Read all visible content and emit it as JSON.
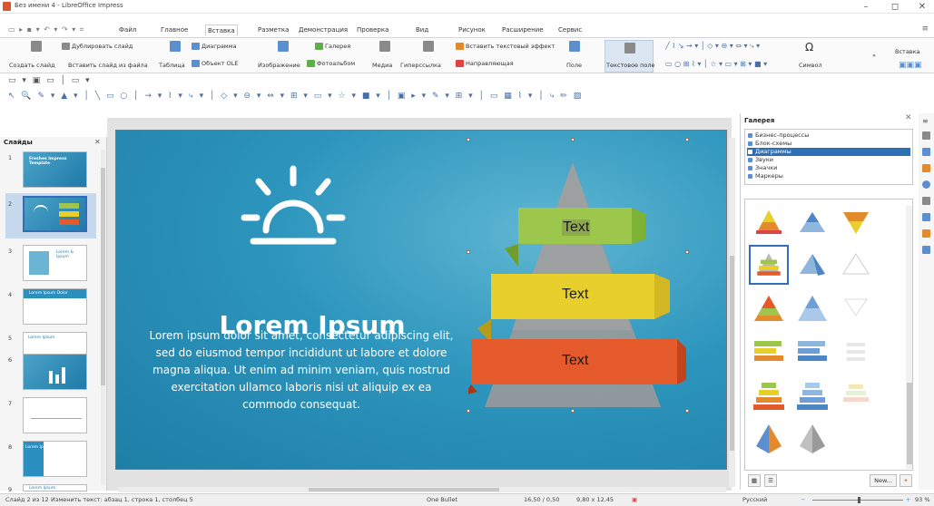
{
  "window": {
    "title": "Без имени 4 - LibreOffice Impress",
    "controls": [
      "–",
      "◻",
      "✕"
    ]
  },
  "menu": {
    "tabs": [
      {
        "label": "Файл"
      },
      {
        "label": "Главное"
      },
      {
        "label": "Вставка"
      },
      {
        "label": "Разметка"
      },
      {
        "label": "Демонстрация"
      },
      {
        "label": "Проверка"
      },
      {
        "label": "Вид"
      },
      {
        "label": "Рисунок"
      },
      {
        "label": "Расширение"
      },
      {
        "label": "Сервис"
      }
    ],
    "active_tab": "Вставка"
  },
  "ribbon": {
    "new_slide": "Создать слайд",
    "duplicate_slide": "Дублировать слайд",
    "insert_slide_from_file": "Вставить слайд из файла",
    "table": "Таблица",
    "chart": "Диаграмма",
    "ole_object": "Объект OLE",
    "image": "Изображение",
    "gallery": "Галерея",
    "photo_album": "Фотоальбом",
    "media": "Медиа",
    "hyperlink": "Гиперссылка",
    "fontwork": "Вставить текстовый эффект",
    "guide": "Направляющая",
    "field": "Поле",
    "text_box": "Текстовое поле",
    "symbol": "Символ",
    "overflow": "»",
    "insert_menu": "Вставка"
  },
  "slides_pane": {
    "title": "Слайды",
    "close": "✕",
    "slides": [
      {
        "num": "1",
        "title": "Freshes Impress Template"
      },
      {
        "num": "2",
        "title": ""
      },
      {
        "num": "3",
        "title": "Lorem & Ipsum"
      },
      {
        "num": "4",
        "title": "Lorem Ipsum Dolor"
      },
      {
        "num": "5",
        "title": "Lorem Ipsum"
      },
      {
        "num": "6",
        "title": ""
      },
      {
        "num": "7",
        "title": ""
      },
      {
        "num": "8",
        "title": "Lorem Ipsum"
      },
      {
        "num": "9",
        "title": "Lorem Ipsum"
      }
    ],
    "selected": "2"
  },
  "slide": {
    "title": "Lorem Ipsum",
    "body": "Lorem ipsum dolor sit amet, consectetur adipiscing elit, sed do eiusmod tempor incididunt ut labore et dolore magna aliqua. Ut enim ad minim veniam, quis nostrud exercitation ullamco laboris nisi ut aliquip ex ea commodo consequat.",
    "pyramid_labels": [
      "Text",
      "Text",
      "Text"
    ],
    "colors": {
      "band1": "#9dc64c",
      "band2": "#e8cf2c",
      "band3": "#e55a2b",
      "pyramid": "#9a9a9a"
    }
  },
  "gallery": {
    "title": "Галерея",
    "themes": [
      "Бизнес-процессы",
      "Блок-схемы",
      "Диаграммы",
      "Звуки",
      "Значки",
      "Маркеры"
    ],
    "selected_theme": "Диаграммы",
    "new_button": "New..."
  },
  "status": {
    "slide_pos": "Слайд 2 из 12",
    "edit_state": "Изменить текст: абзац 1, строка 1, столбец 5",
    "layout": "One Bullet",
    "position": "16,50 / 0,50",
    "size": "9,80 x 12,45",
    "language": "Русский",
    "zoom": "93 %"
  }
}
